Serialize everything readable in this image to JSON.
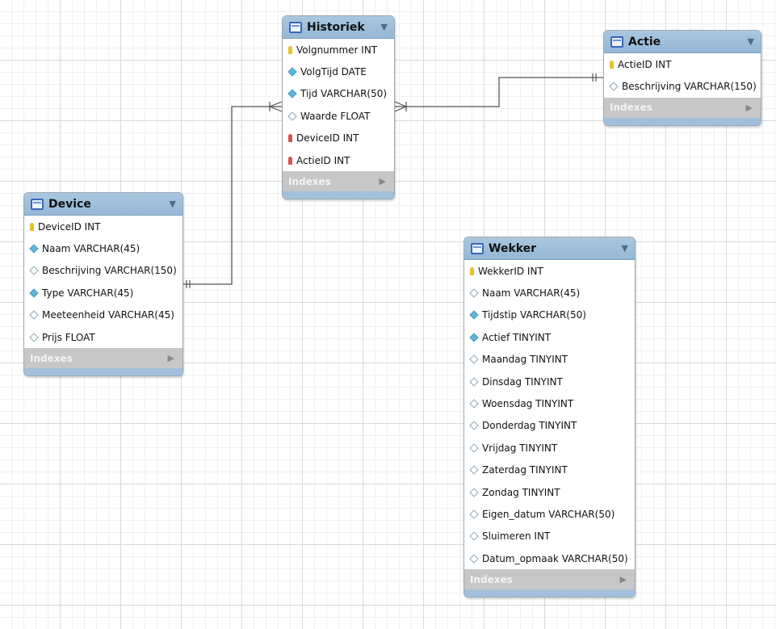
{
  "colors": {
    "header": "#a9c7e0",
    "indexes_bar": "#c7c7c7",
    "primary_key": "#e8c32c",
    "foreign_key": "#d9534f",
    "not_null": "#62b4d8",
    "relation_line": "#555555"
  },
  "tables": {
    "historiek": {
      "title": "Historiek",
      "columns": [
        {
          "text": "Volgnummer INT",
          "icon": "primary-key-icon"
        },
        {
          "text": "VolgTijd DATE",
          "icon": "not-null-column-icon"
        },
        {
          "text": "Tijd VARCHAR(50)",
          "icon": "not-null-column-icon"
        },
        {
          "text": "Waarde FLOAT",
          "icon": "column-icon"
        },
        {
          "text": "DeviceID INT",
          "icon": "foreign-key-icon"
        },
        {
          "text": "ActieID INT",
          "icon": "foreign-key-icon"
        }
      ],
      "indexes_label": "Indexes"
    },
    "actie": {
      "title": "Actie",
      "columns": [
        {
          "text": "ActieID INT",
          "icon": "primary-key-icon"
        },
        {
          "text": "Beschrijving VARCHAR(150)",
          "icon": "column-icon"
        }
      ],
      "indexes_label": "Indexes"
    },
    "device": {
      "title": "Device",
      "columns": [
        {
          "text": "DeviceID INT",
          "icon": "primary-key-icon"
        },
        {
          "text": "Naam VARCHAR(45)",
          "icon": "not-null-column-icon"
        },
        {
          "text": "Beschrijving VARCHAR(150)",
          "icon": "column-icon"
        },
        {
          "text": "Type VARCHAR(45)",
          "icon": "not-null-column-icon"
        },
        {
          "text": "Meeteenheid VARCHAR(45)",
          "icon": "column-icon"
        },
        {
          "text": "Prijs FLOAT",
          "icon": "column-icon"
        }
      ],
      "indexes_label": "Indexes"
    },
    "wekker": {
      "title": "Wekker",
      "columns": [
        {
          "text": "WekkerID INT",
          "icon": "primary-key-icon"
        },
        {
          "text": "Naam VARCHAR(45)",
          "icon": "column-icon"
        },
        {
          "text": "Tijdstip VARCHAR(50)",
          "icon": "not-null-column-icon"
        },
        {
          "text": "Actief TINYINT",
          "icon": "not-null-column-icon"
        },
        {
          "text": "Maandag TINYINT",
          "icon": "column-icon"
        },
        {
          "text": "Dinsdag TINYINT",
          "icon": "column-icon"
        },
        {
          "text": "Woensdag TINYINT",
          "icon": "column-icon"
        },
        {
          "text": "Donderdag TINYINT",
          "icon": "column-icon"
        },
        {
          "text": "Vrijdag TINYINT",
          "icon": "column-icon"
        },
        {
          "text": "Zaterdag TINYINT",
          "icon": "column-icon"
        },
        {
          "text": "Zondag TINYINT",
          "icon": "column-icon"
        },
        {
          "text": "Eigen_datum VARCHAR(50)",
          "icon": "column-icon"
        },
        {
          "text": "Sluimeren INT",
          "icon": "column-icon"
        },
        {
          "text": "Datum_opmaak VARCHAR(50)",
          "icon": "column-icon"
        }
      ],
      "indexes_label": "Indexes"
    }
  }
}
